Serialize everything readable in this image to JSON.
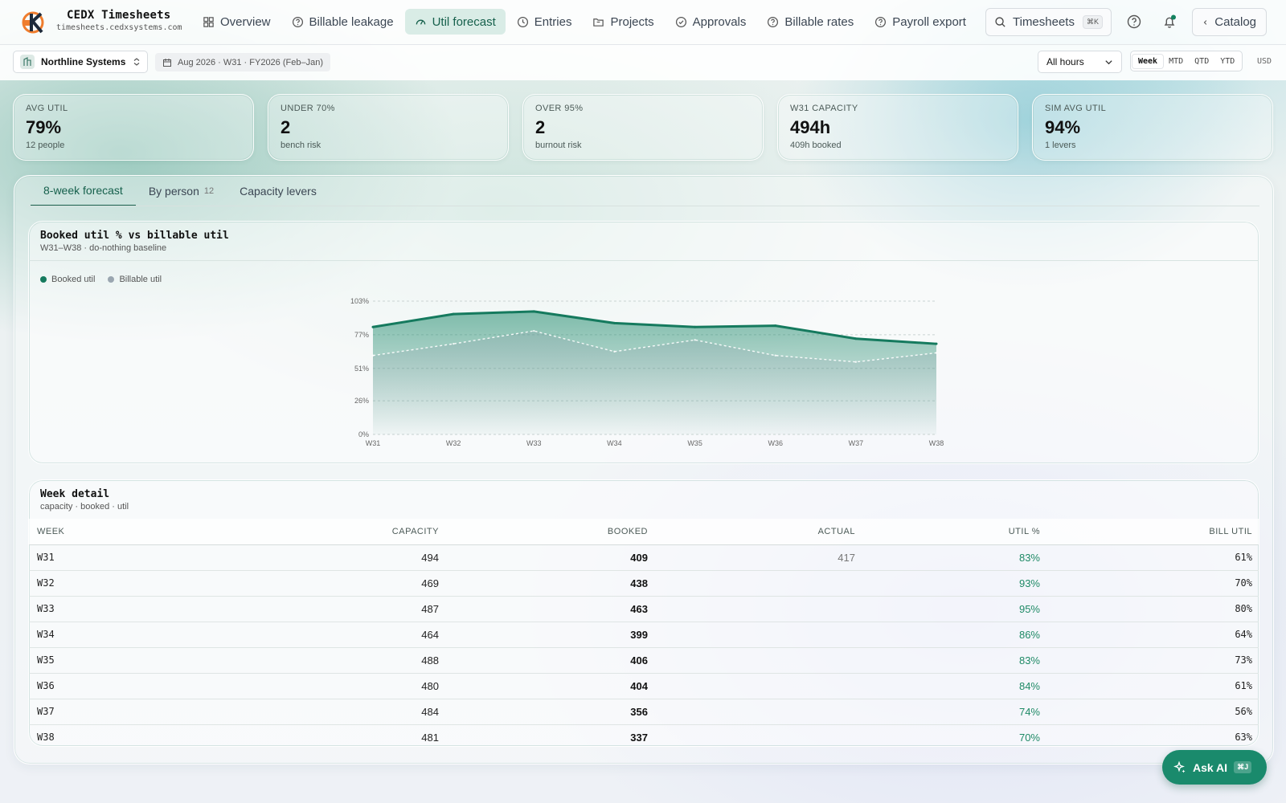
{
  "app": {
    "title": "CEDX Timesheets",
    "domain": "timesheets.cedxsystems.com"
  },
  "nav": [
    {
      "label": "Overview",
      "icon": "grid-icon"
    },
    {
      "label": "Billable leakage",
      "icon": "help-circle-icon"
    },
    {
      "label": "Util forecast",
      "icon": "gauge-icon",
      "active": true
    },
    {
      "label": "Entries",
      "icon": "clock-icon"
    },
    {
      "label": "Projects",
      "icon": "folder-icon"
    },
    {
      "label": "Approvals",
      "icon": "check-circle-icon"
    },
    {
      "label": "Billable rates",
      "icon": "help-circle-icon"
    },
    {
      "label": "Payroll export",
      "icon": "help-circle-icon"
    }
  ],
  "search": {
    "label": "Timesheets",
    "shortcut": "⌘K"
  },
  "catalog_label": "Catalog",
  "filters": {
    "org": "Northline Systems",
    "period": "Aug 2026 · W31 · FY2026 (Feb–Jan)",
    "hours": "All hours",
    "ranges": [
      "Week",
      "MTD",
      "QTD",
      "YTD"
    ],
    "active_range": "Week",
    "currency": "USD"
  },
  "kpis": [
    {
      "label": "Avg util",
      "value": "79%",
      "sub": "12 people"
    },
    {
      "label": "Under 70%",
      "value": "2",
      "sub": "bench risk"
    },
    {
      "label": "Over 95%",
      "value": "2",
      "sub": "burnout risk"
    },
    {
      "label": "W31 capacity",
      "value": "494h",
      "sub": "409h booked"
    },
    {
      "label": "Sim avg util",
      "value": "94%",
      "sub": "1 levers"
    }
  ],
  "tabs": [
    {
      "label": "8-week forecast",
      "count": ""
    },
    {
      "label": "By person",
      "count": "12"
    },
    {
      "label": "Capacity levers",
      "count": ""
    }
  ],
  "chart_card": {
    "title": "Booked util % vs billable util",
    "subtitle": "W31–W38 · do-nothing baseline"
  },
  "chart_data": {
    "type": "area",
    "title": "Booked util % vs billable util",
    "categories": [
      "W31",
      "W32",
      "W33",
      "W34",
      "W35",
      "W36",
      "W37",
      "W38"
    ],
    "series": [
      {
        "name": "Booked util",
        "values": [
          83,
          93,
          95,
          86,
          83,
          84,
          74,
          70
        ],
        "color": "#157a5e"
      },
      {
        "name": "Billable util",
        "values": [
          61,
          70,
          80,
          64,
          73,
          61,
          56,
          63
        ],
        "color": "#9aa6b0"
      }
    ],
    "y_ticks": [
      "0%",
      "26%",
      "51%",
      "77%",
      "103%"
    ],
    "ylim": [
      0,
      103
    ],
    "grid": true,
    "legend": "top-left"
  },
  "table_card": {
    "title": "Week detail",
    "subtitle": "capacity · booked · util"
  },
  "table": {
    "headers": [
      "Week",
      "Capacity",
      "Booked",
      "Actual",
      "Util %",
      "Bill util"
    ],
    "rows": [
      [
        "W31",
        "494",
        "409",
        "417",
        "83%",
        "61%"
      ],
      [
        "W32",
        "469",
        "438",
        "",
        "93%",
        "70%"
      ],
      [
        "W33",
        "487",
        "463",
        "",
        "95%",
        "80%"
      ],
      [
        "W34",
        "464",
        "399",
        "",
        "86%",
        "64%"
      ],
      [
        "W35",
        "488",
        "406",
        "",
        "83%",
        "73%"
      ],
      [
        "W36",
        "480",
        "404",
        "",
        "84%",
        "61%"
      ],
      [
        "W37",
        "484",
        "356",
        "",
        "74%",
        "56%"
      ],
      [
        "W38",
        "481",
        "337",
        "",
        "70%",
        "63%"
      ]
    ]
  },
  "ask_ai": {
    "label": "Ask AI",
    "shortcut": "⌘J"
  },
  "colors": {
    "accent": "#157a5e",
    "active_nav_bg": "#d9ece6",
    "util_text": "#1f8a66"
  }
}
